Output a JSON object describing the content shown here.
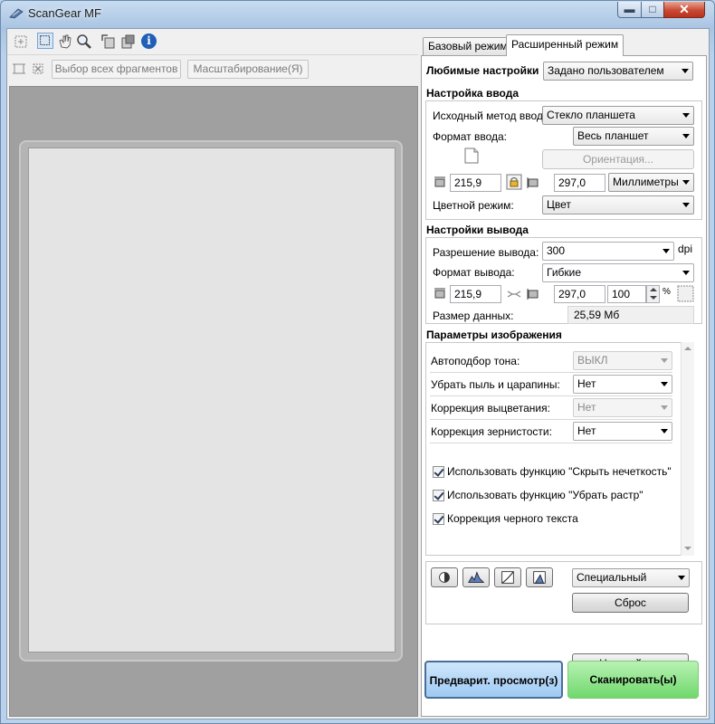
{
  "window": {
    "title": "ScanGear MF",
    "min_symbol": "▬",
    "max_symbol": "□",
    "close_symbol": "✕"
  },
  "toolbar": {
    "select_all_label": "Выбор всех фрагментов",
    "zoom_label": "Масштабирование(Я)",
    "info_symbol": "i"
  },
  "tabs": [
    {
      "label": "Базовый режим",
      "active": false
    },
    {
      "label": "Расширенный режим",
      "active": true
    }
  ],
  "favorites": {
    "label": "Любимые настройки",
    "value": "Задано пользователем"
  },
  "input_settings": {
    "heading": "Настройка ввода",
    "source_label": "Исходный метод ввода:",
    "source_value": "Стекло планшета",
    "format_label": "Формат ввода:",
    "format_value": "Весь планшет",
    "orientation_label": "Ориентация...",
    "width": "215,9",
    "height": "297,0",
    "units": "Миллиметры",
    "color_mode_label": "Цветной режим:",
    "color_mode_value": "Цвет"
  },
  "output_settings": {
    "heading": "Настройки вывода",
    "resolution_label": "Разрешение вывода:",
    "resolution_value": "300",
    "resolution_unit": "dpi",
    "format_label": "Формат вывода:",
    "format_value": "Гибкие",
    "width": "215,9",
    "height": "297,0",
    "scale": "100",
    "scale_unit": "%",
    "data_size_label": "Размер данных:",
    "data_size_value": "25,59 Мб"
  },
  "image_settings": {
    "heading": "Параметры изображения",
    "rows": [
      {
        "label": "Автоподбор тона:",
        "value": "ВЫКЛ",
        "disabled": true
      },
      {
        "label": "Убрать пыль и царапины:",
        "value": "Нет",
        "disabled": false
      },
      {
        "label": "Коррекция выцветания:",
        "value": "Нет",
        "disabled": true
      },
      {
        "label": "Коррекция зернистости:",
        "value": "Нет",
        "disabled": false
      }
    ],
    "checkboxes": [
      {
        "label": "Использовать функцию \"Скрыть нечеткость\"",
        "checked": true
      },
      {
        "label": "Использовать функцию \"Убрать растр\"",
        "checked": true
      },
      {
        "label": "Коррекция черного текста",
        "checked": true
      }
    ]
  },
  "tone": {
    "preset_value": "Специальный",
    "reset_label": "Сброс"
  },
  "settings_button": "Настройки...",
  "preview_button": "Предварит. просмотр(з)",
  "scan_button": "Сканировать(ы)",
  "colors": {
    "preview_button": "#a9d2f7",
    "scan_button": "#8ee48a",
    "title_bar": "#b9d1ea",
    "close_button": "#c94a33"
  }
}
